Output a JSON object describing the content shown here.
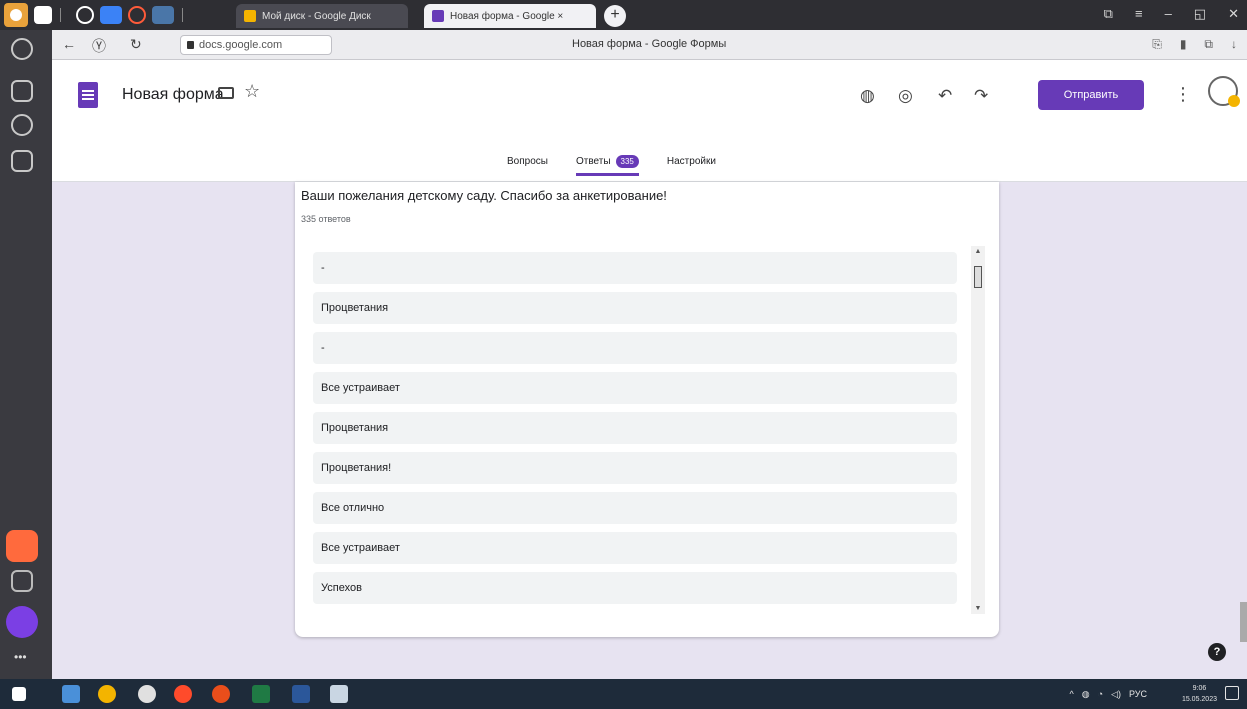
{
  "browser": {
    "tabs": [
      {
        "label": "Мой диск - Google Диск",
        "active": false
      },
      {
        "label": "Новая форма - Google ×",
        "active": true
      }
    ],
    "new_tab_label": "+",
    "url": "docs.google.com",
    "page_title": "Новая форма - Google Формы"
  },
  "form": {
    "title": "Новая форма",
    "send_label": "Отправить",
    "tabs": [
      {
        "label": "Вопросы"
      },
      {
        "label": "Ответы",
        "badge": "335"
      },
      {
        "label": "Настройки"
      }
    ]
  },
  "question": {
    "title": "Ваши пожелания детскому саду. Спасибо за анкетирование!",
    "count": "335 ответов",
    "answers": [
      "-",
      "Процветания",
      "-",
      "Все устраивает",
      "Процветания",
      "Процветания!",
      "Все отлично",
      "Все устраивает",
      "Успехов"
    ]
  },
  "taskbar": {
    "lang": "РУС",
    "time": "9:06",
    "date": "15.05.2023"
  },
  "colors": {
    "accent": "#673ab7",
    "content_bg": "#e7e3f1"
  },
  "help_label": "?"
}
